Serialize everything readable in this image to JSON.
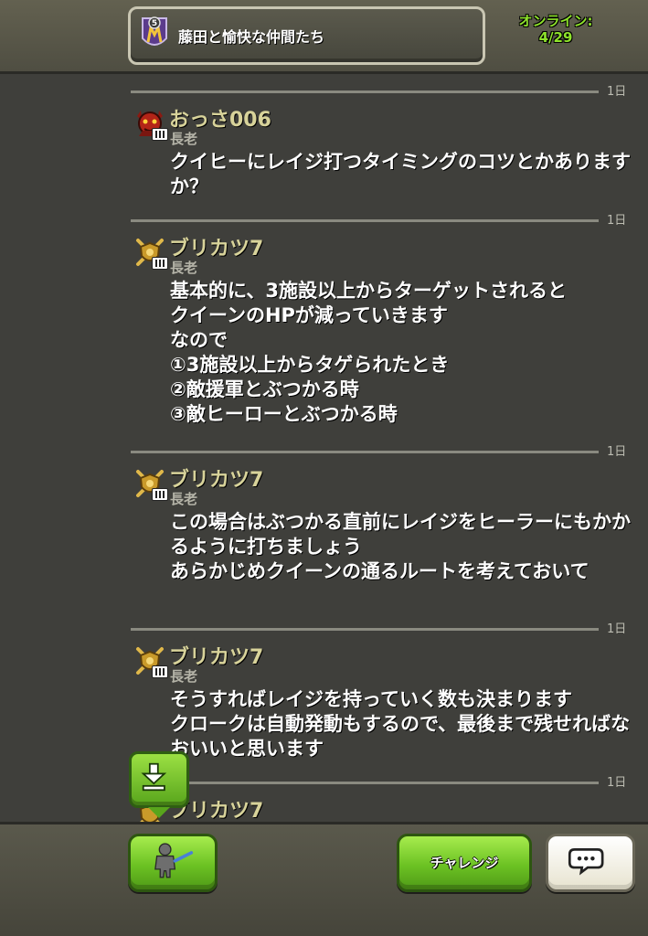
{
  "header": {
    "clan_level": "5",
    "clan_name": "藤田と愉快な仲間たち",
    "online_label": "オンライン:",
    "online_count": "4/29"
  },
  "messages": [
    {
      "time": "1日",
      "name": "おっさ006",
      "role": "長老",
      "avatar": "red-demon-icon",
      "text": "クイヒーにレイジ打つタイミングのコツとかありますか？"
    },
    {
      "time": "1日",
      "name": "ブリカツ7",
      "role": "長老",
      "avatar": "crossed-swords-shield-icon",
      "text": "基本的に、3施設以上からターゲットされると\nクイーンのHPが減っていきます\nなので\n①3施設以上からタゲられたとき\n②敵援軍とぶつかる時\n③敵ヒーローとぶつかる時"
    },
    {
      "time": "1日",
      "name": "ブリカツ7",
      "role": "長老",
      "avatar": "crossed-swords-shield-icon",
      "text": "この場合はぶつかる直前にレイジをヒーラーにもかかるように打ちましょう\nあらかじめクイーンの通るルートを考えておいて"
    },
    {
      "time": "1日",
      "name": "ブリカツ7",
      "role": "長老",
      "avatar": "crossed-swords-shield-icon",
      "text": "そうすればレイジを持っていく数も決まります\nクロークは自動発動もするので、最後まで残せればなおいいと思います"
    },
    {
      "time": "1日",
      "name": "ブリカツ7",
      "role": "",
      "avatar": "crossed-swords-shield-icon",
      "text": ""
    }
  ],
  "bottom_bar": {
    "challenge_label": "チャレンジ"
  },
  "colors": {
    "name": "#d8d39a",
    "online": "#8ee22b",
    "button_green": "#6cc223"
  }
}
